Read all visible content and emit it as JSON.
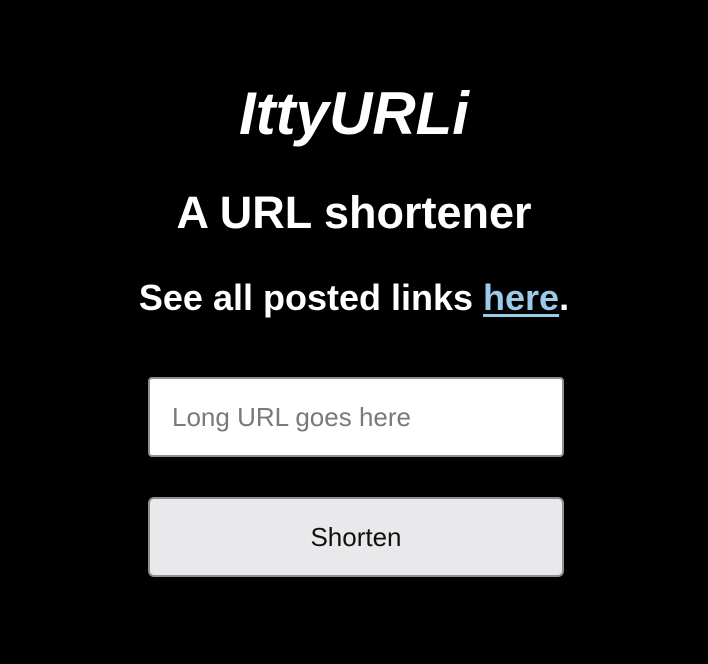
{
  "header": {
    "title": "IttyURLi",
    "subtitle": "A URL shortener",
    "links_prefix": "See all posted links ",
    "links_link_text": "here",
    "links_suffix": "."
  },
  "form": {
    "url_input_placeholder": "Long URL goes here",
    "url_input_value": "",
    "submit_label": "Shorten"
  },
  "colors": {
    "background": "#000000",
    "text": "#ffffff",
    "link": "#9ccbea",
    "button_background": "#e9e9eb"
  }
}
